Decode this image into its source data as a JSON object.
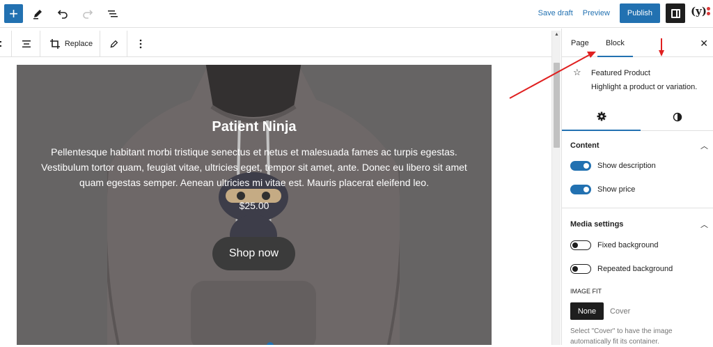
{
  "topbar": {
    "add_icon": "plus-icon",
    "tools_icon": "pencil-icon",
    "undo_icon": "undo-icon",
    "redo_icon": "redo-icon",
    "list_view_icon": "list-view-icon",
    "save_draft": "Save draft",
    "preview": "Preview",
    "publish": "Publish",
    "settings_icon": "sidebar-icon",
    "yoast_icon": "yoast-icon",
    "yoast_text": "(y)"
  },
  "block_toolbar": {
    "align_icon": "align-icon",
    "crop_icon": "crop-icon",
    "replace": "Replace",
    "edit_icon": "pencil-icon",
    "more_icon": "more-vertical-icon"
  },
  "featured_product": {
    "title": "Patient Ninja",
    "description": "Pellentesque habitant morbi tristique senectus et netus et malesuada fames ac turpis egestas. Vestibulum tortor quam, feugiat vitae, ultricies eget, tempor sit amet, ante. Donec eu libero sit amet quam egestas semper. Aenean ultricies mi vitae est. Mauris placerat eleifend leo.",
    "price": "$25.00",
    "button": "Shop now"
  },
  "sidebar": {
    "tabs": [
      "Page",
      "Block"
    ],
    "active_tab": "Block",
    "close_icon": "close-icon",
    "block": {
      "icon": "star-icon",
      "name": "Featured Product",
      "description": "Highlight a product or variation."
    },
    "sub_tabs": {
      "settings_icon": "gear-icon",
      "styles_icon": "contrast-icon"
    },
    "content_panel": {
      "title": "Content",
      "toggles": [
        {
          "label": "Show description",
          "on": true
        },
        {
          "label": "Show price",
          "on": true
        }
      ]
    },
    "media_panel": {
      "title": "Media settings",
      "toggles": [
        {
          "label": "Fixed background",
          "on": false
        },
        {
          "label": "Repeated background",
          "on": false
        }
      ],
      "image_fit_label": "IMAGE FIT",
      "image_fit_options": [
        "None",
        "Cover"
      ],
      "image_fit_selected": "None",
      "help": "Select \"Cover\" to have the image automatically fit its container."
    }
  },
  "colors": {
    "accent": "#2271b1",
    "annotation": "#e02020",
    "dark": "#1e1e1e"
  }
}
